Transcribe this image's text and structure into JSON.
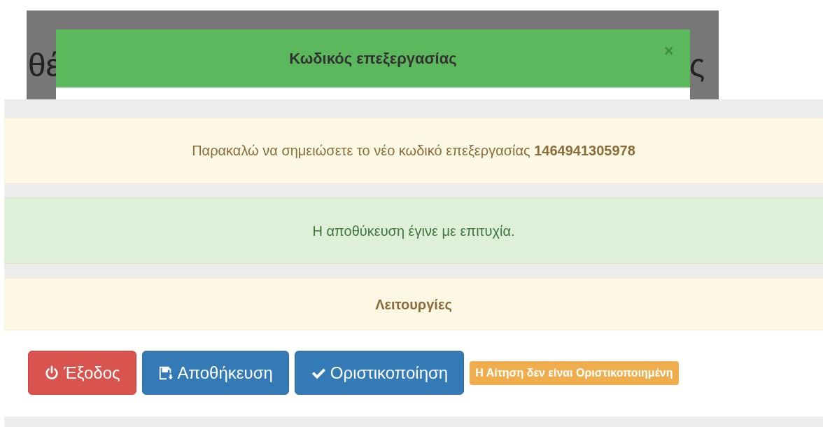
{
  "background_fragments": [
    "θέ",
    "ς"
  ],
  "modal": {
    "title": "Κωδικός επεξεργασίας",
    "close": "×"
  },
  "warning_message": {
    "text": "Παρακαλώ να σημειώσετε το νέο κωδικό επεξεργασίας **1464941305978**"
  },
  "success_message": {
    "text": "Η αποθύκευση έγινε με επιτυχία."
  },
  "panel": {
    "title": "Λειτουργίες",
    "buttons": [
      {
        "label": "Έξοδος",
        "kind": "exit"
      },
      {
        "label": "Αποθήκευση",
        "kind": "save"
      },
      {
        "label": "Οριστικοποίηση",
        "kind": "finalize"
      }
    ],
    "status_badge": "Η Αίτηση δεν είναι Οριστικοποιημένη"
  }
}
